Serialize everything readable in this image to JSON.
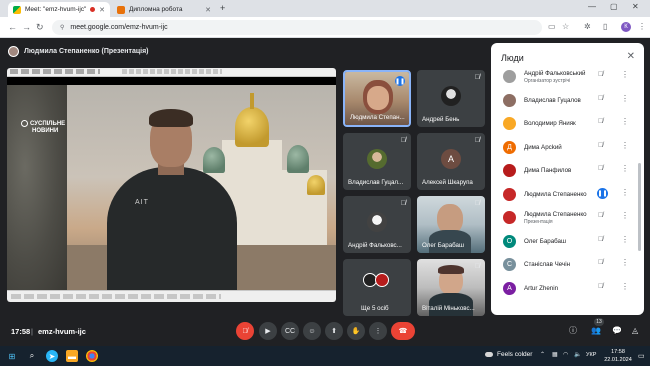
{
  "browser": {
    "tabs": [
      {
        "title": "Meet: \"emz-hvum-ijc\"",
        "active": true
      },
      {
        "title": "Дипломна робота",
        "active": false
      }
    ],
    "new_tab": "+",
    "url": "meet.google.com/emz-hvum-ijc",
    "profile_initial": "К",
    "window_controls": {
      "minimize": "—",
      "maximize": "▢",
      "close": "✕"
    }
  },
  "meet": {
    "presenting_label": "Людмила Степаненко (Презентація)",
    "presentation": {
      "logo_line1": "СУСПІЛЬНЕ",
      "logo_line2": "НОВИНИ",
      "shirt_text": "AIT"
    },
    "tiles": [
      {
        "name": "Людмила Степан...",
        "kind": "photo"
      },
      {
        "name": "Андрей Бень",
        "kind": "avatar"
      },
      {
        "name": "Владислав Гуцал...",
        "kind": "avatar"
      },
      {
        "name": "Алексей Шкарупа",
        "kind": "letter",
        "letter": "А"
      },
      {
        "name": "Андрій Фальковс...",
        "kind": "avatar"
      },
      {
        "name": "Олег Барабаш",
        "kind": "photo"
      },
      {
        "name": "Ще 5 осіб",
        "kind": "group"
      },
      {
        "name": "Віталій Міньковс...",
        "kind": "photo"
      }
    ],
    "people_panel": {
      "title": "Люди",
      "participants": [
        {
          "name": "Андрій Фальковський",
          "sub": "Організатор зустрічі",
          "color": "#9e9e9e",
          "letter": ""
        },
        {
          "name": "Владислав Гуцалов",
          "sub": "",
          "color": "#8d6e63",
          "letter": ""
        },
        {
          "name": "Володимир Янияк",
          "sub": "",
          "color": "#f9a825",
          "letter": ""
        },
        {
          "name": "Дима Арсkий",
          "sub": "",
          "color": "#ef6c00",
          "letter": "Д"
        },
        {
          "name": "Дима Панфилов",
          "sub": "",
          "color": "#b71c1c",
          "letter": ""
        },
        {
          "name": "Людмила Степаненко",
          "sub": "",
          "color": "#c62828",
          "letter": "",
          "speaking": true
        },
        {
          "name": "Людмила Степаненко",
          "sub": "Презентація",
          "color": "#c62828",
          "letter": ""
        },
        {
          "name": "Олег Барабаш",
          "sub": "",
          "color": "#00897b",
          "letter": "О"
        },
        {
          "name": "Станіслав Чечін",
          "sub": "",
          "color": "#78909c",
          "letter": "С"
        },
        {
          "name": "Artur Zhenin",
          "sub": "",
          "color": "#7b1fa2",
          "letter": "A"
        }
      ]
    },
    "bottom_bar": {
      "time": "17:58",
      "separator": "|",
      "meeting_code": "emz-hvum-ijc",
      "participant_count": "13"
    }
  },
  "taskbar": {
    "weather": "Feels colder",
    "language": "УКР",
    "clock_time": "17:58",
    "clock_date": "22.01.2024"
  }
}
